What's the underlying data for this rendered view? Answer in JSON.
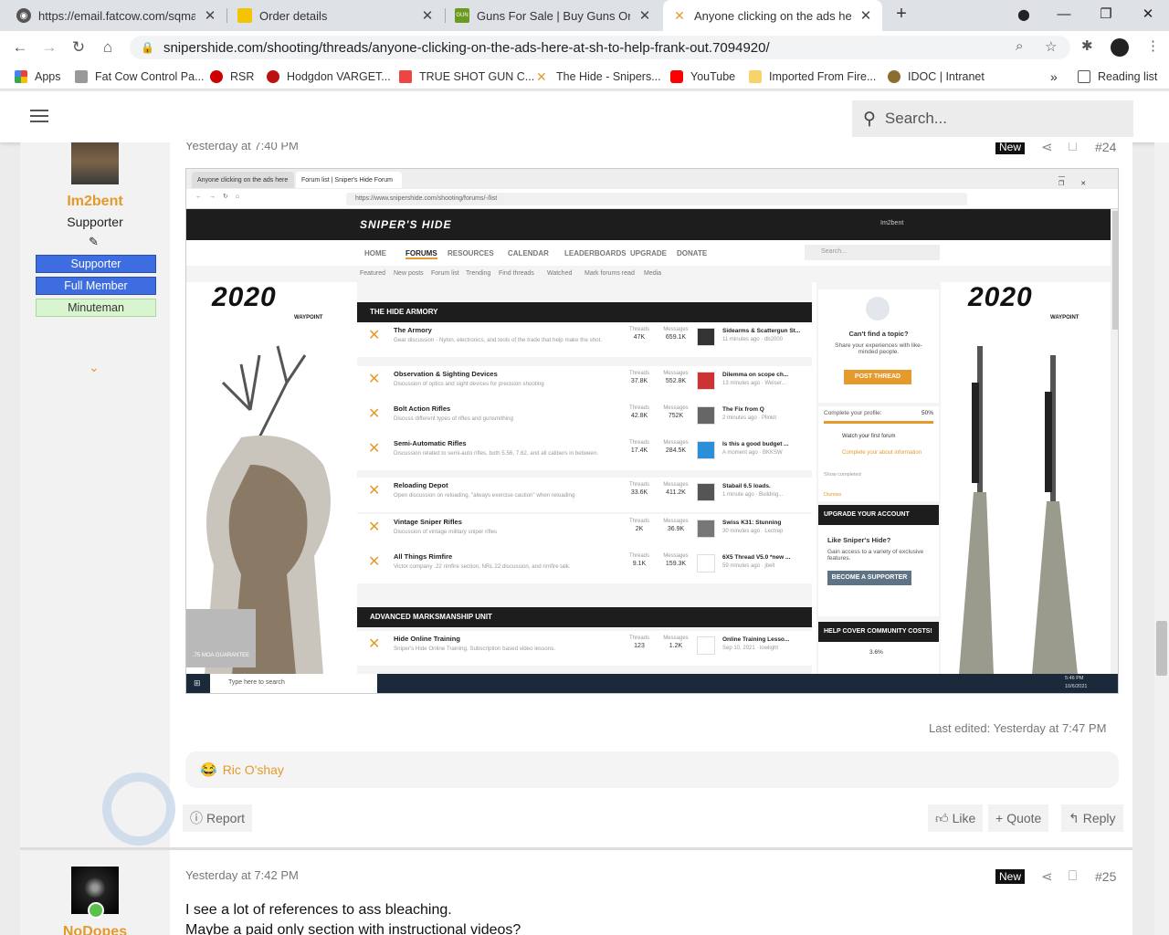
{
  "browser": {
    "tabs": [
      {
        "label": "https://email.fatcow.com/sqmail/",
        "active": false
      },
      {
        "label": "Order details",
        "active": false
      },
      {
        "label": "Guns For Sale | Buy Guns Online |",
        "active": false
      },
      {
        "label": "Anyone clicking on the ads here",
        "active": true
      }
    ],
    "url": "snipershide.com/shooting/threads/anyone-clicking-on-the-ads-here-at-sh-to-help-frank-out.7094920/",
    "bookmarks": [
      "Apps",
      "Fat Cow Control Pa...",
      "RSR",
      "Hodgdon VARGET...",
      "TRUE SHOT GUN C...",
      "The Hide - Snipers...",
      "YouTube",
      "Imported From Fire...",
      "IDOC | Intranet"
    ],
    "reading_list": "Reading list"
  },
  "site_header": {
    "search_placeholder": "Search..."
  },
  "post24": {
    "username": "Im2bent",
    "user_title": "Supporter",
    "badges": [
      "Supporter",
      "Full Member",
      "Minuteman"
    ],
    "timestamp": "Yesterday at 7:40 PM",
    "new_label": "New",
    "post_number": "#24",
    "last_edited": "Last edited: Yesterday at 7:47 PM",
    "reaction_user": "Ric O'shay",
    "report_label": "Report",
    "like_label": "Like",
    "quote_label": "Quote",
    "reply_label": "Reply"
  },
  "post25": {
    "username": "NoDopes",
    "timestamp": "Yesterday at 7:42 PM",
    "new_label": "New",
    "post_number": "#25",
    "line1": "I see a lot of references to ass bleaching.",
    "line2": "Maybe a paid only section with instructional videos?"
  },
  "embedded_screenshot": {
    "tab1": "Anyone clicking on the ads here",
    "tab2": "Forum list | Sniper's Hide Forum",
    "url": "https://www.snipershide.com/shooting/forums/-/list",
    "logo": "SNIPER'S HIDE",
    "user": "Im2bent",
    "nav": [
      "HOME",
      "FORUMS",
      "RESOURCES",
      "CALENDAR",
      "LEADERBOARDS",
      "UPGRADE",
      "DONATE"
    ],
    "search": "Search...",
    "subnav": [
      "Featured",
      "New posts",
      "Forum list",
      "Trending",
      "Find threads",
      "Watched",
      "Mark forums read",
      "Media"
    ],
    "ad_text": "2020",
    "ad_sub": "WAYPOINT",
    "ad_left_badge": ".75 MOA GUARANTEE",
    "cat1": "THE HIDE ARMORY",
    "cat2": "ADVANCED MARKSMANSHIP UNIT",
    "threads_label": "Threads",
    "messages_label": "Messages",
    "forums": [
      {
        "title": "The Armory",
        "desc": "Gear discussion - Nylon, electronics, and tools of the trade that help make the shot.",
        "threads": "47K",
        "messages": "659.1K",
        "latest": "Sidearms & Scattergun St...",
        "meta": "11 minutes ago · db2000"
      },
      {
        "title": "Observation & Sighting Devices",
        "desc": "Discussion of optics and sight devices for precision shooting",
        "threads": "37.8K",
        "messages": "552.8K",
        "latest": "Dilemma on scope ch...",
        "meta": "13 minutes ago · Weiser..."
      },
      {
        "title": "Bolt Action Rifles",
        "desc": "Discuss different types of rifles and gunsmithing",
        "threads": "42.8K",
        "messages": "752K",
        "latest": "The Fix from Q",
        "meta": "2 minutes ago · Plinkit"
      },
      {
        "title": "Semi-Automatic Rifles",
        "desc": "Discussion related to semi-auto rifles, both 5.56, 7.62, and all calibers in between.",
        "threads": "17.4K",
        "messages": "284.5K",
        "latest": "Is this a good budget ...",
        "meta": "A moment ago · BKKSW"
      },
      {
        "title": "Reloading Depot",
        "desc": "Open discussion on reloading, \"always exercise caution\" when reloading",
        "threads": "33.6K",
        "messages": "411.2K",
        "latest": "Stabail 6.5 loads.",
        "meta": "1 minute ago · Building..."
      },
      {
        "title": "Vintage Sniper Rifles",
        "desc": "Discussion of vintage military sniper rifles",
        "threads": "2K",
        "messages": "36.9K",
        "latest": "Swiss K31: Stunning",
        "meta": "30 minutes ago · Lectrep"
      },
      {
        "title": "All Things Rimfire",
        "desc": "Victor company .22 rimfire section, NRL 22 discussion, and rimfire talk.",
        "threads": "9.1K",
        "messages": "159.3K",
        "latest": "6X5 Thread V5.0 *new ...",
        "meta": "59 minutes ago · jbell"
      },
      {
        "title": "Hide Online Training",
        "desc": "Sniper's Hide Online Training, Subscription based video lessons.",
        "threads": "123",
        "messages": "1.2K",
        "latest": "Online Training Lesso...",
        "meta": "Sep 10, 2021 · lowlight"
      }
    ],
    "side": {
      "topic_title": "Can't find a topic?",
      "topic_desc": "Share your experiences with like-minded people.",
      "post_thread": "POST THREAD",
      "profile_label": "Complete your profile:",
      "profile_pct": "50%",
      "task1": "Watch your first forum",
      "task2": "Complete your about information",
      "show_completed": "Show completed",
      "dismiss": "Dismiss",
      "upgrade_hd": "UPGRADE YOUR ACCOUNT",
      "upgrade_title": "Like Sniper's Hide?",
      "upgrade_desc": "Gain access to a variety of exclusive features.",
      "become": "BECOME A SUPPORTER",
      "costs_hd": "HELP COVER COMMUNITY COSTS!",
      "costs_pct": "3.6%"
    },
    "taskbar_search": "Type here to search",
    "clock": "5:46 PM",
    "date": "10/6/2021"
  }
}
